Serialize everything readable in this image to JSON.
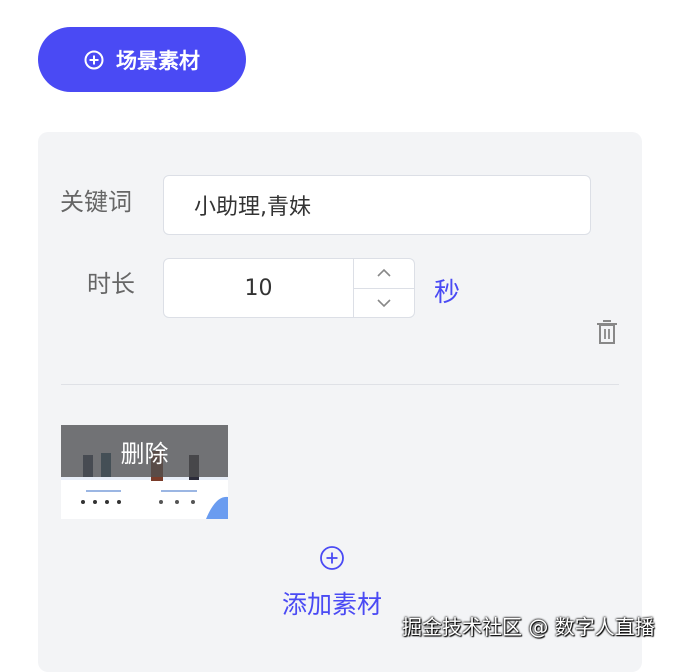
{
  "header": {
    "scene_button_label": "场景素材"
  },
  "form": {
    "keyword": {
      "label": "关键词",
      "value": "小助理,青妹"
    },
    "duration": {
      "label": "时长",
      "value": "10",
      "unit": "秒"
    }
  },
  "material": {
    "delete_label": "删除",
    "add_label": "添加素材"
  },
  "watermark": "掘金技术社区 @ 数字人直播",
  "colors": {
    "accent": "#4a4af4",
    "card_bg": "#f3f4f6"
  }
}
